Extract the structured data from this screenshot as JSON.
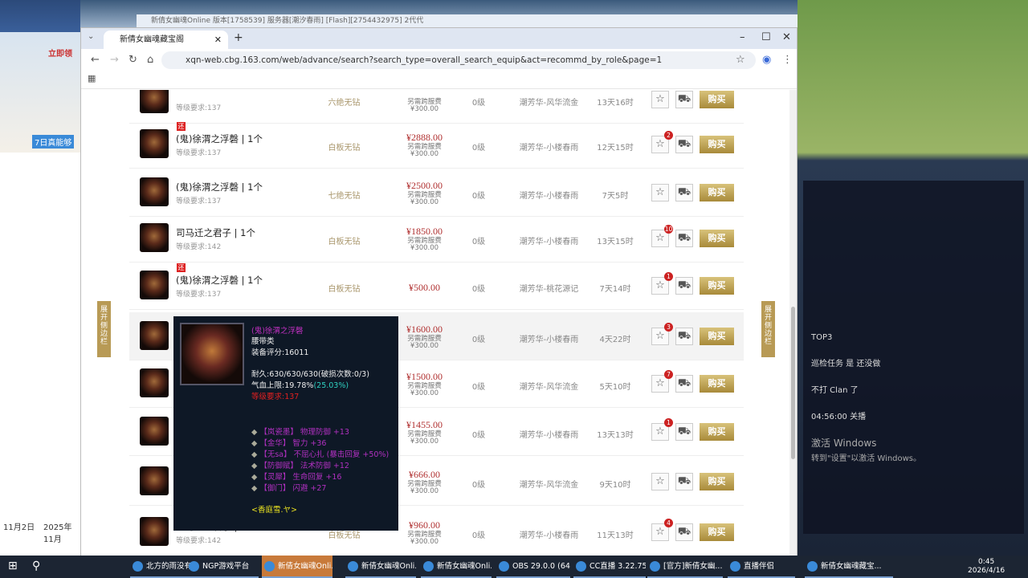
{
  "desktop": {
    "left_labels": [
      "立即领",
      "7日真能够",
      "11月2日",
      "2025年11月"
    ],
    "game_window_title": "新倩女幽魂Online 版本[1758539] 服务器[潮汐春雨] [Flash][2754432975]  2代代",
    "chat_lines": [
      "TOP3",
      "巡检任务 是 还没做",
      "不打 Clan 了",
      "04:56:00 关播",
      "激活 Windows",
      "转到\"设置\"以激活 Windows。"
    ]
  },
  "browser": {
    "tab_title": "新倩女幽魂藏宝阁",
    "url": "xqn-web.cbg.163.com/web/advance/search?search_type=overall_search_equip&act=recommd_by_role&page=1"
  },
  "side_toggle_label": "展开侧边栏",
  "rows": [
    {
      "name": "",
      "req": "等级要求:137",
      "attr": "六绝无钻",
      "price": "",
      "fee": "另需跨服费",
      "fee_amt": "¥300.00",
      "level": "0级",
      "server": "潮芳华-风华流金",
      "time": "13天16时",
      "fav": "",
      "tag": ""
    },
    {
      "name": "(鬼)徐渭之浮磬 | 1个",
      "req": "等级要求:137",
      "attr": "白板无钻",
      "price": "¥2888.00",
      "fee": "另需跨服费",
      "fee_amt": "¥300.00",
      "level": "0级",
      "server": "潮芳华-小楼春雨",
      "time": "12天15时",
      "fav": "2",
      "tag": "还"
    },
    {
      "name": "(鬼)徐渭之浮磬 | 1个",
      "req": "等级要求:137",
      "attr": "七绝无钻",
      "price": "¥2500.00",
      "fee": "另需跨服费",
      "fee_amt": "¥300.00",
      "level": "0级",
      "server": "潮芳华-小楼春雨",
      "time": "7天5时",
      "fav": "",
      "tag": ""
    },
    {
      "name": "司马迁之君子 | 1个",
      "req": "等级要求:142",
      "attr": "白板无钻",
      "price": "¥1850.00",
      "fee": "另需跨服费",
      "fee_amt": "¥300.00",
      "level": "0级",
      "server": "潮芳华-小楼春雨",
      "time": "13天15时",
      "fav": "10",
      "tag": ""
    },
    {
      "name": "(鬼)徐渭之浮磬 | 1个",
      "req": "等级要求:137",
      "attr": "白板无钻",
      "price": "¥500.00",
      "fee": "",
      "fee_amt": "",
      "level": "0级",
      "server": "潮芳华-桃花源记",
      "time": "7天14时",
      "fav": "1",
      "tag": "还"
    },
    {
      "name": "",
      "req": "",
      "attr": "",
      "price": "¥1600.00",
      "fee": "另需跨服费",
      "fee_amt": "¥300.00",
      "level": "0级",
      "server": "潮芳华-小楼春雨",
      "time": "4天22时",
      "fav": "3",
      "tag": ""
    },
    {
      "name": "",
      "req": "",
      "attr": "",
      "price": "¥1500.00",
      "fee": "另需跨服费",
      "fee_amt": "¥300.00",
      "level": "0级",
      "server": "潮芳华-风华流金",
      "time": "5天10时",
      "fav": "7",
      "tag": ""
    },
    {
      "name": "",
      "req": "",
      "attr": "",
      "price": "¥1455.00",
      "fee": "另需跨服费",
      "fee_amt": "¥300.00",
      "level": "0级",
      "server": "潮芳华-小楼春雨",
      "time": "13天13时",
      "fav": "1",
      "tag": ""
    },
    {
      "name": "",
      "req": "",
      "attr": "",
      "price": "¥666.00",
      "fee": "另需跨服费",
      "fee_amt": "¥300.00",
      "level": "0级",
      "server": "潮芳华-风华流金",
      "time": "9天10时",
      "fav": "",
      "tag": ""
    },
    {
      "name": "司马迁之君子 | 1个",
      "req": "等级要求:142",
      "attr": "白板无钻",
      "price": "¥960.00",
      "fee": "另需跨服费",
      "fee_amt": "¥300.00",
      "level": "0级",
      "server": "潮芳华-小楼春雨",
      "time": "11天13时",
      "fav": "4",
      "tag": ""
    }
  ],
  "buy_label": "购买",
  "tooltip": {
    "title": "(鬼)徐渭之浮磬",
    "type": "腰带类",
    "score": "装备评分:16011",
    "durability": "耐久:630/630/630(破损次数:0/3)",
    "hp": "气血上限:19.78%",
    "hp_extra": "(25.03%)",
    "req": "等级要求:137",
    "attrs": [
      "【岚瓷墨】 物理防御 +13",
      "【金华】 智力 +36",
      "【无sa】 不屈心扎 (暴击回复 +50%)",
      "【防御赋】 法术防御 +12",
      "【灵犀】 生命回复 +16",
      "【御门】 闪避 +27"
    ],
    "maker": "<香庭雪.ヤ>"
  },
  "taskbar": {
    "items": [
      "北方的雨没有...",
      "NGP游戏平台",
      "新倩女幽魂Onli...",
      "新倩女幽魂Onli...",
      "新倩女幽魂Onli...",
      "OBS 29.0.0 (64...",
      "CC直播 3.22.75",
      "[官方]新倩女幽...",
      "直播伴侣",
      "新倩女幽魂藏宝..."
    ],
    "time": "0:45",
    "date": "2026/4/16"
  }
}
